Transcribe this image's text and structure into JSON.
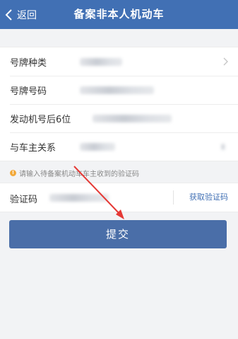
{
  "header": {
    "back_label": "返回",
    "title": "备案非本人机动车"
  },
  "form": {
    "rows": [
      {
        "label": "号牌种类"
      },
      {
        "label": "号牌号码"
      },
      {
        "label": "发动机号后6位"
      },
      {
        "label": "与车主关系"
      }
    ]
  },
  "hint": {
    "icon_glyph": "!",
    "text": "请输入待备案机动车车主收到的验证码"
  },
  "verification": {
    "label": "验证码",
    "get_code_label": "获取验证码"
  },
  "submit_label": "提交",
  "colors": {
    "header": "#4170b4",
    "submit": "#4a6ea8",
    "link": "#4170b4",
    "annotation_arrow": "#e53935"
  }
}
